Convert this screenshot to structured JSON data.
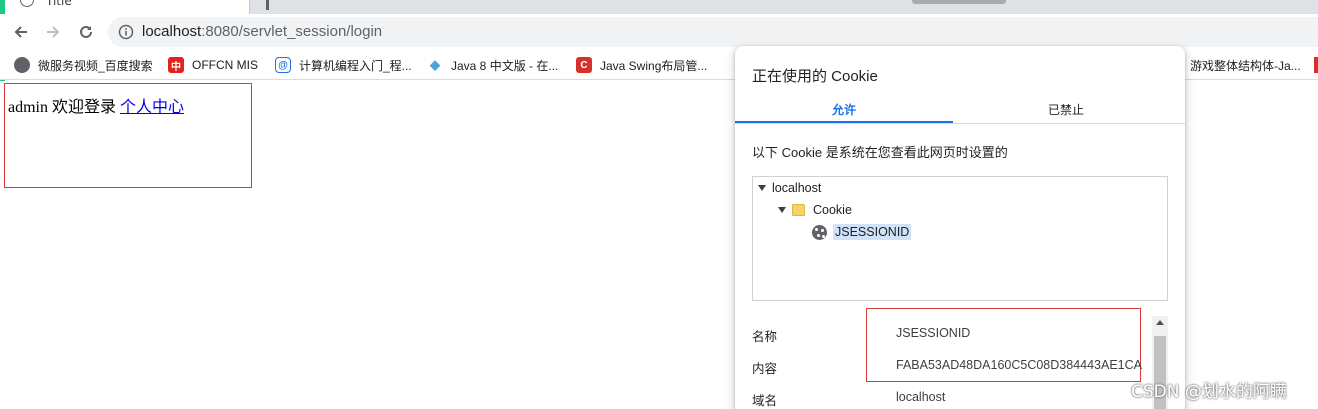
{
  "browser": {
    "tab": {
      "title": "Title"
    },
    "address": {
      "host": "localhost",
      "path": ":8080/servlet_session/login"
    },
    "bookmarks": [
      {
        "label": "微服务视频_百度搜索",
        "icon": "globe-icon"
      },
      {
        "label": "OFFCN MIS",
        "icon": "offcn-logo-icon"
      },
      {
        "label": "计算机编程入门_程...",
        "icon": "at-sign-icon"
      },
      {
        "label": "Java 8 中文版 - 在...",
        "icon": "runoob-icon"
      },
      {
        "label": "Java Swing布局管...",
        "icon": "csdn-c-icon"
      },
      {
        "label": "游戏整体结构体-Ja...",
        "icon": "bookmark-icon"
      }
    ]
  },
  "page": {
    "welcome_text": "admin 欢迎登录 ",
    "profile_link": "个人中心"
  },
  "cookie_popup": {
    "title": "正在使用的 Cookie",
    "tabs": [
      {
        "label": "允许",
        "active": true
      },
      {
        "label": "已禁止",
        "active": false
      }
    ],
    "description": "以下 Cookie 是系统在您查看此网页时设置的",
    "tree": {
      "root": "localhost",
      "folder": "Cookie",
      "item": "JSESSIONID"
    },
    "details": [
      {
        "label": "名称",
        "value": "JSESSIONID"
      },
      {
        "label": "内容",
        "value": "FABA53AD48DA160C5C08D384443AE1CA"
      },
      {
        "label": "域名",
        "value": "localhost"
      }
    ]
  },
  "watermark": "CSDN @划水的阿瞒",
  "colors": {
    "link": "#0000ee",
    "accent_blue": "#1a73e8",
    "annotation_red": "#d93a3a",
    "window_accent": "#1ec980"
  }
}
